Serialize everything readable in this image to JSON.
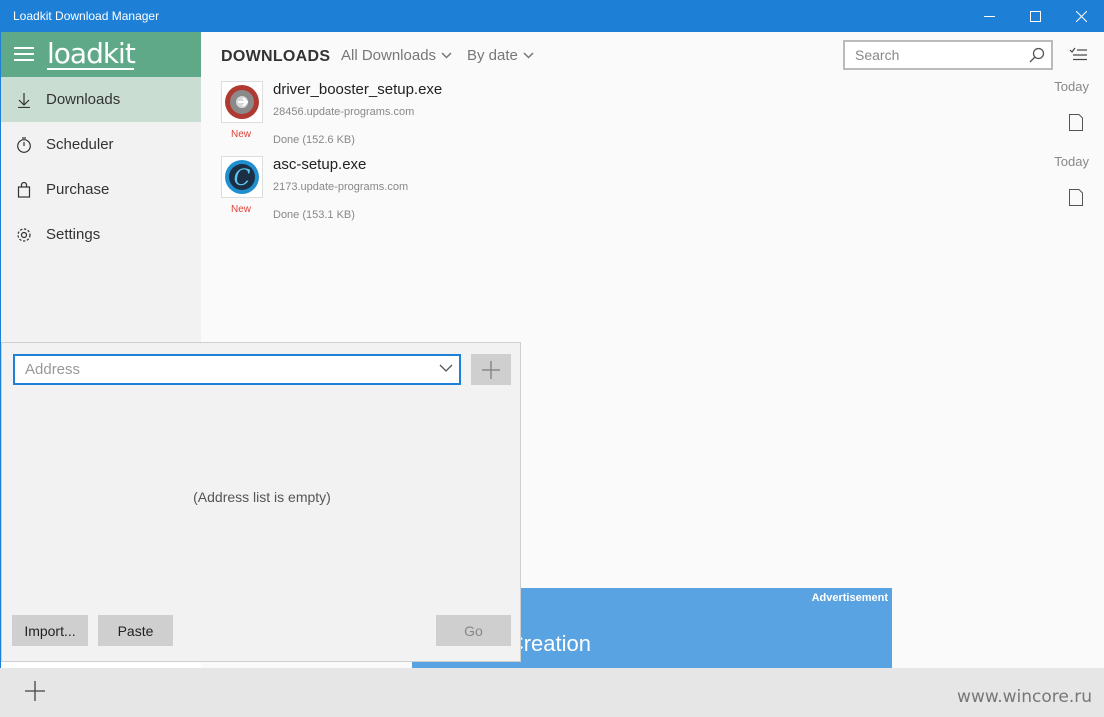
{
  "window": {
    "title": "Loadkit Download Manager"
  },
  "sidebar": {
    "logo": "loadkit",
    "items": [
      {
        "label": "Downloads",
        "icon": "download-icon",
        "active": true
      },
      {
        "label": "Scheduler",
        "icon": "timer-icon",
        "active": false
      },
      {
        "label": "Purchase",
        "icon": "bag-icon",
        "active": false
      },
      {
        "label": "Settings",
        "icon": "gear-icon",
        "active": false
      }
    ]
  },
  "header": {
    "title": "DOWNLOADS",
    "filter_label": "All Downloads",
    "sort_label": "By date",
    "search_placeholder": "Search"
  },
  "downloads": [
    {
      "name": "driver_booster_setup.exe",
      "host": "28456.update-programs.com",
      "badge": "New",
      "status": "Done (152.6 KB)",
      "date": "Today",
      "icon": "driver-booster-app-icon"
    },
    {
      "name": "asc-setup.exe",
      "host": "2173.update-programs.com",
      "badge": "New",
      "status": "Done (153.1 KB)",
      "date": "Today",
      "icon": "advanced-systemcare-app-icon"
    }
  ],
  "advertisement": {
    "label": "Advertisement",
    "text": "ebsites Creation"
  },
  "address_popup": {
    "placeholder": "Address",
    "empty_message": "(Address list is empty)",
    "import_label": "Import...",
    "paste_label": "Paste",
    "go_label": "Go"
  },
  "footer": {
    "watermark": "www.wincore.ru"
  },
  "colors": {
    "titlebar": "#1e7fd6",
    "sidebar_header": "#5fa988",
    "nav_active": "#c9ddd2",
    "new_badge": "#e0413a",
    "ad_background": "#5aa3e2"
  }
}
